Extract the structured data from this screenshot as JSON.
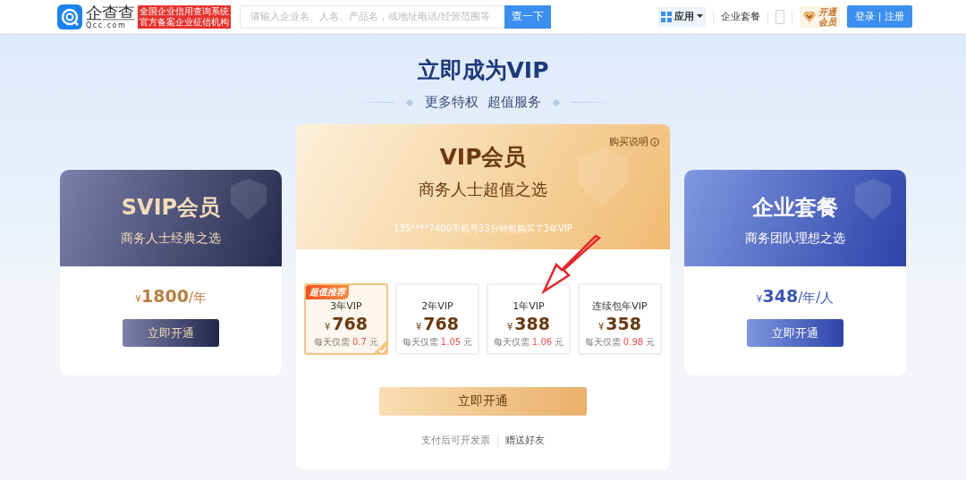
{
  "header": {
    "logo": {
      "name": "企查查",
      "domain": "Qcc.com"
    },
    "badge_lines": [
      "全国企业信用查询系统",
      "官方备案企业征信机构"
    ],
    "search": {
      "placeholder": "请输入企业名、人名、产品名，或地址电话/经营范围等",
      "button": "查一下"
    },
    "app_menu": "应用",
    "package_link": "企业套餐",
    "vip_badge": [
      "开通",
      "会员"
    ],
    "login": "登录 | 注册"
  },
  "hero": {
    "title": "立即成为VIP",
    "subtitle": "更多特权  超值服务"
  },
  "side_plans": [
    {
      "kind": "svip",
      "title": "SVIP会员",
      "subtitle": "商务人士经典之选",
      "currency": "¥",
      "price": "1800",
      "unit": "/年",
      "button": "立即开通"
    },
    {
      "kind": "enterprise",
      "title": "企业套餐",
      "subtitle": "商务团队理想之选",
      "currency": "¥",
      "price": "348",
      "unit": "/年/人",
      "button": "立即开通"
    }
  ],
  "vip": {
    "title": "VIP会员",
    "subtitle": "商务人士超值之选",
    "info": "购买说明",
    "ticker": "135****7400手机号33分钟前购买了3年VIP",
    "options": [
      {
        "tag": "超值推荐",
        "name": "3年VIP",
        "currency": "¥",
        "price": "768",
        "per_day_label": "每天仅需",
        "per_day": "0.7",
        "per_day_unit": "元",
        "selected": true
      },
      {
        "name": "2年VIP",
        "currency": "¥",
        "price": "768",
        "per_day_label": "每天仅需",
        "per_day": "1.05",
        "per_day_unit": "元",
        "selected": false
      },
      {
        "name": "1年VIP",
        "currency": "¥",
        "price": "388",
        "per_day_label": "每天仅需",
        "per_day": "1.06",
        "per_day_unit": "元",
        "selected": false
      },
      {
        "name": "连续包年VIP",
        "currency": "¥",
        "price": "358",
        "per_day_label": "每天仅需",
        "per_day": "0.98",
        "per_day_unit": "元",
        "selected": false
      }
    ],
    "button": "立即开通",
    "footer_links": [
      "支付后可开发票",
      "赠送好友"
    ]
  }
}
